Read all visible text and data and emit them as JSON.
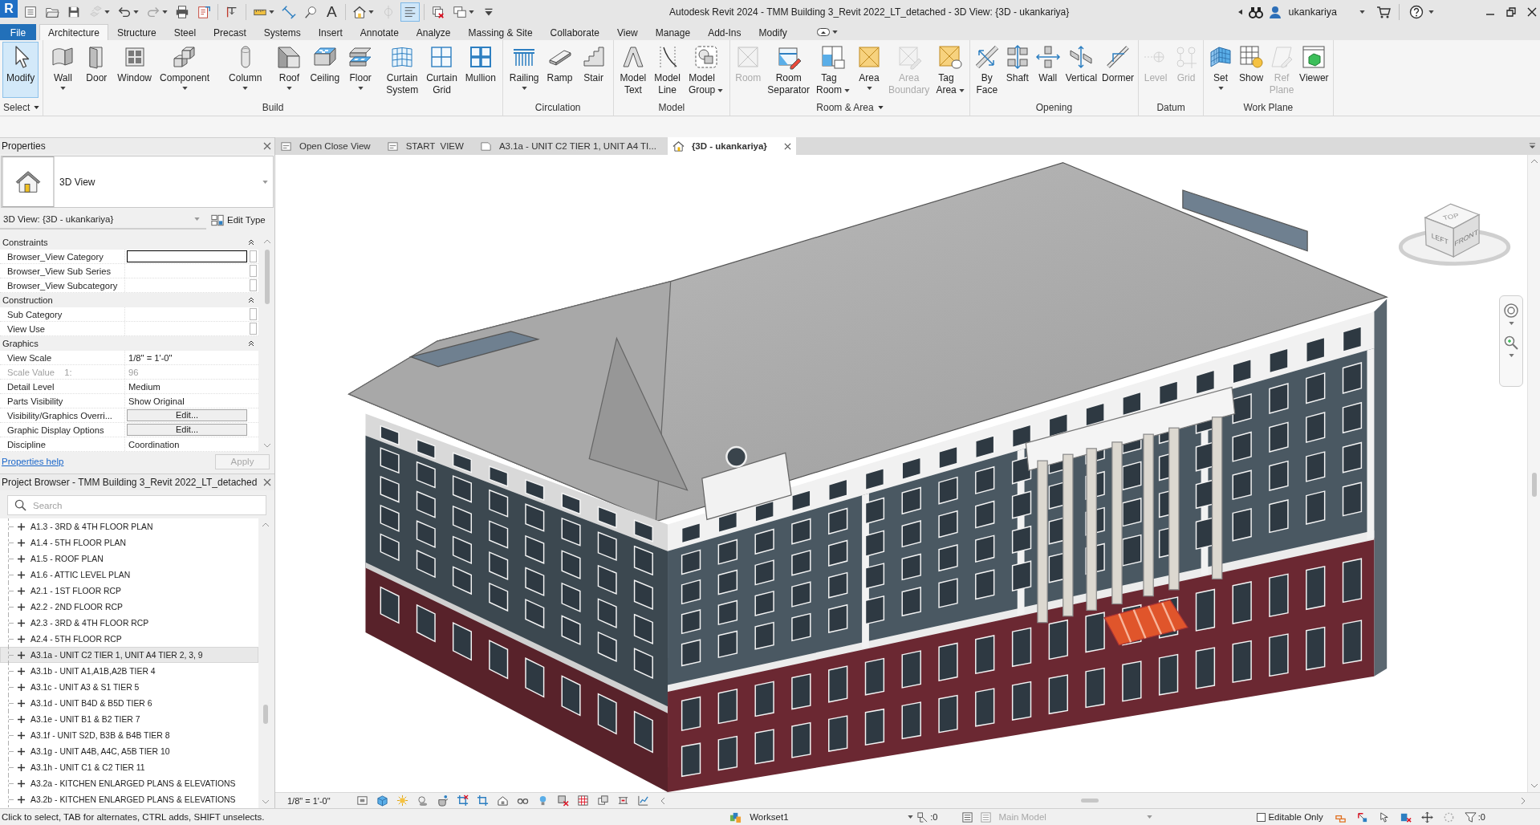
{
  "window": {
    "logo": "R",
    "title": "Autodesk Revit 2024 - TMM Building 3_Revit 2022_LT_detached - 3D View: {3D - ukankariya}",
    "user": "ukankariya"
  },
  "quick_access": [
    [
      {
        "kind": "list",
        "disabled": false,
        "on": false,
        "menu": false
      },
      {
        "kind": "open",
        "disabled": false,
        "on": false,
        "menu": false
      },
      {
        "kind": "save",
        "disabled": false,
        "on": false,
        "menu": false
      },
      {
        "kind": "sync",
        "disabled": true,
        "on": false,
        "menu": true
      },
      {
        "kind": "undo",
        "disabled": false,
        "on": false,
        "menu": true
      },
      {
        "kind": "redo",
        "disabled": true,
        "on": false,
        "menu": true
      },
      {
        "kind": "print",
        "disabled": false,
        "on": false,
        "menu": false
      },
      {
        "kind": "export",
        "disabled": false,
        "on": false,
        "menu": false
      }
    ],
    [
      {
        "kind": "level",
        "disabled": false,
        "on": false,
        "menu": false
      }
    ],
    [
      {
        "kind": "measure",
        "disabled": false,
        "on": false,
        "menu": true
      },
      {
        "kind": "dimension",
        "disabled": false,
        "on": false,
        "menu": false
      },
      {
        "kind": "tag",
        "disabled": false,
        "on": false,
        "menu": false
      },
      {
        "kind": "text",
        "glyph": "A",
        "disabled": false,
        "on": false,
        "menu": false
      }
    ],
    [
      {
        "kind": "home",
        "disabled": false,
        "on": false,
        "menu": true
      },
      {
        "kind": "section",
        "disabled": true,
        "on": false,
        "menu": false
      },
      {
        "kind": "thin_lines",
        "disabled": false,
        "on": true,
        "menu": false
      }
    ],
    [
      {
        "kind": "close_hidden",
        "disabled": false,
        "on": false,
        "menu": false
      },
      {
        "kind": "switch_windows",
        "disabled": false,
        "on": false,
        "menu": true
      },
      {
        "kind": "customize",
        "disabled": false,
        "on": false,
        "menu": false
      }
    ]
  ],
  "ribbon_tabs": [
    {
      "label": "File",
      "kind": "file",
      "selected": false
    },
    {
      "label": "Architecture",
      "kind": "tab",
      "selected": true
    },
    {
      "label": "Structure",
      "kind": "tab",
      "selected": false
    },
    {
      "label": "Steel",
      "kind": "tab",
      "selected": false
    },
    {
      "label": "Precast",
      "kind": "tab",
      "selected": false
    },
    {
      "label": "Systems",
      "kind": "tab",
      "selected": false
    },
    {
      "label": "Insert",
      "kind": "tab",
      "selected": false
    },
    {
      "label": "Annotate",
      "kind": "tab",
      "selected": false
    },
    {
      "label": "Analyze",
      "kind": "tab",
      "selected": false
    },
    {
      "label": "Massing & Site",
      "kind": "tab",
      "selected": false
    },
    {
      "label": "Collaborate",
      "kind": "tab",
      "selected": false
    },
    {
      "label": "View",
      "kind": "tab",
      "selected": false
    },
    {
      "label": "Manage",
      "kind": "tab",
      "selected": false
    },
    {
      "label": "Add-Ins",
      "kind": "tab",
      "selected": false
    },
    {
      "label": "Modify",
      "kind": "tab",
      "selected": false
    }
  ],
  "ribbon_panels": [
    {
      "title": "Select",
      "menu": true,
      "tools": [
        {
          "label": "Modify",
          "kind": "pointer",
          "selected": true,
          "disabled": false,
          "dropdown": false
        }
      ]
    },
    {
      "title": "Build",
      "menu": false,
      "tools": [
        {
          "label": "Wall",
          "kind": "wall",
          "selected": false,
          "disabled": false,
          "dropdown": true
        },
        {
          "label": "Door",
          "kind": "door",
          "selected": false,
          "disabled": false,
          "dropdown": false
        },
        {
          "label": "Window",
          "kind": "window",
          "selected": false,
          "disabled": false,
          "dropdown": false
        },
        {
          "label": "Component",
          "kind": "component",
          "selected": false,
          "disabled": false,
          "dropdown": true
        },
        {
          "label": "Column",
          "kind": "column",
          "selected": false,
          "disabled": false,
          "dropdown": true
        },
        {
          "label": "Roof",
          "kind": "roof",
          "selected": false,
          "disabled": false,
          "dropdown": true
        },
        {
          "label": "Ceiling",
          "kind": "ceiling",
          "selected": false,
          "disabled": false,
          "dropdown": false
        },
        {
          "label": "Floor",
          "kind": "floor",
          "selected": false,
          "disabled": false,
          "dropdown": true
        },
        {
          "label": "Curtain System",
          "kind": "curtain_system",
          "selected": false,
          "disabled": false,
          "dropdown": false
        },
        {
          "label": "Curtain Grid",
          "kind": "curtain_grid",
          "selected": false,
          "disabled": false,
          "dropdown": false
        },
        {
          "label": "Mullion",
          "kind": "mullion",
          "selected": false,
          "disabled": false,
          "dropdown": false
        }
      ]
    },
    {
      "title": "Circulation",
      "menu": false,
      "tools": [
        {
          "label": "Railing",
          "kind": "railing",
          "selected": false,
          "disabled": false,
          "dropdown": true
        },
        {
          "label": "Ramp",
          "kind": "ramp",
          "selected": false,
          "disabled": false,
          "dropdown": false
        },
        {
          "label": "Stair",
          "kind": "stair",
          "selected": false,
          "disabled": false,
          "dropdown": false
        }
      ]
    },
    {
      "title": "Model",
      "menu": false,
      "tools": [
        {
          "label": "Model Text",
          "kind": "model_text",
          "selected": false,
          "disabled": false,
          "dropdown": false
        },
        {
          "label": "Model Line",
          "kind": "model_line",
          "selected": false,
          "disabled": false,
          "dropdown": false
        },
        {
          "label": "Model Group",
          "kind": "model_group",
          "selected": false,
          "disabled": false,
          "dropdown": true
        }
      ]
    },
    {
      "title": "Room & Area",
      "menu": true,
      "tools": [
        {
          "label": "Room",
          "kind": "room",
          "selected": false,
          "disabled": true,
          "dropdown": false
        },
        {
          "label": "Room Separator",
          "kind": "room_separator",
          "selected": false,
          "disabled": false,
          "dropdown": false
        },
        {
          "label": "Tag Room",
          "kind": "tag_room",
          "selected": false,
          "disabled": false,
          "dropdown": true
        },
        {
          "label": "Area",
          "kind": "area",
          "selected": false,
          "disabled": false,
          "dropdown": true
        },
        {
          "label": "Area Boundary",
          "kind": "area_boundary",
          "selected": false,
          "disabled": true,
          "dropdown": false
        },
        {
          "label": "Tag Area",
          "kind": "tag_area",
          "selected": false,
          "disabled": false,
          "dropdown": true
        }
      ]
    },
    {
      "title": "Opening",
      "menu": false,
      "tools": [
        {
          "label": "By Face",
          "kind": "by_face",
          "selected": false,
          "disabled": false,
          "dropdown": false
        },
        {
          "label": "Shaft",
          "kind": "shaft",
          "selected": false,
          "disabled": false,
          "dropdown": false
        },
        {
          "label": "Wall",
          "kind": "wall_opening",
          "selected": false,
          "disabled": false,
          "dropdown": false
        },
        {
          "label": "Vertical",
          "kind": "vertical",
          "selected": false,
          "disabled": false,
          "dropdown": false
        },
        {
          "label": "Dormer",
          "kind": "dormer",
          "selected": false,
          "disabled": false,
          "dropdown": false
        }
      ]
    },
    {
      "title": "Datum",
      "menu": false,
      "tools": [
        {
          "label": "Level",
          "kind": "level",
          "selected": false,
          "disabled": true,
          "dropdown": false
        },
        {
          "label": "Grid",
          "kind": "grid",
          "selected": false,
          "disabled": true,
          "dropdown": false
        }
      ]
    },
    {
      "title": "Work Plane",
      "menu": false,
      "tools": [
        {
          "label": "Set",
          "kind": "set",
          "selected": false,
          "disabled": false,
          "dropdown": true
        },
        {
          "label": "Show",
          "kind": "show",
          "selected": false,
          "disabled": false,
          "dropdown": false
        },
        {
          "label": "Ref Plane",
          "kind": "ref_plane",
          "selected": false,
          "disabled": true,
          "dropdown": false
        },
        {
          "label": "Viewer",
          "kind": "viewer",
          "selected": false,
          "disabled": false,
          "dropdown": false
        }
      ]
    }
  ],
  "properties": {
    "title": "Properties",
    "type_name": "3D View",
    "instance": "3D View: {3D - ukankariya}",
    "edit_type": "Edit Type",
    "groups": [
      {
        "name": "Constraints",
        "expanded": true,
        "rows": [
          {
            "name": "Browser_View Category",
            "kind": "input",
            "param": true,
            "disabled": false
          },
          {
            "name": "Browser_View Sub Series",
            "kind": "text",
            "param": true,
            "disabled": false
          },
          {
            "name": "Browser_View Subcategory",
            "kind": "text",
            "param": true,
            "disabled": false
          }
        ]
      },
      {
        "name": "Construction",
        "expanded": true,
        "rows": [
          {
            "name": "Sub Category",
            "kind": "text",
            "param": true,
            "disabled": false
          },
          {
            "name": "View Use",
            "kind": "text",
            "param": true,
            "disabled": false
          }
        ]
      },
      {
        "name": "Graphics",
        "expanded": true,
        "rows": [
          {
            "name": "View Scale",
            "value": "1/8\" = 1'-0\"",
            "kind": "text",
            "param": false,
            "disabled": false
          },
          {
            "name": "Scale Value    1:",
            "value": "96",
            "kind": "text",
            "param": false,
            "disabled": true
          },
          {
            "name": "Detail Level",
            "value": "Medium",
            "kind": "text",
            "param": false,
            "disabled": false
          },
          {
            "name": "Parts Visibility",
            "value": "Show Original",
            "kind": "text",
            "param": false,
            "disabled": false
          },
          {
            "name": "Visibility/Graphics Overri...",
            "value": "Edit...",
            "kind": "button",
            "param": false,
            "disabled": false
          },
          {
            "name": "Graphic Display Options",
            "value": "Edit...",
            "kind": "button",
            "param": false,
            "disabled": false
          },
          {
            "name": "Discipline",
            "value": "Coordination",
            "kind": "text",
            "param": false,
            "disabled": false
          }
        ]
      }
    ],
    "help": "Properties help",
    "apply": {
      "label": "Apply",
      "disabled": true
    }
  },
  "project_browser": {
    "title": "Project Browser - TMM Building 3_Revit 2022_LT_detached",
    "search_placeholder": "Search",
    "items": [
      {
        "label": "A1.3 - 3RD & 4TH FLOOR PLAN",
        "expanded": false,
        "selected": false
      },
      {
        "label": "A1.4 - 5TH FLOOR PLAN",
        "expanded": false,
        "selected": false
      },
      {
        "label": "A1.5 - ROOF PLAN",
        "expanded": false,
        "selected": false
      },
      {
        "label": "A1.6 - ATTIC LEVEL PLAN",
        "expanded": false,
        "selected": false
      },
      {
        "label": "A2.1 - 1ST FLOOR RCP",
        "expanded": false,
        "selected": false
      },
      {
        "label": "A2.2 - 2ND FLOOR RCP",
        "expanded": false,
        "selected": false
      },
      {
        "label": "A2.3 - 3RD & 4TH FLOOR RCP",
        "expanded": false,
        "selected": false
      },
      {
        "label": "A2.4 - 5TH FLOOR RCP",
        "expanded": false,
        "selected": false
      },
      {
        "label": "A3.1a - UNIT C2 TIER 1, UNIT A4 TIER 2, 3, 9",
        "expanded": false,
        "selected": true
      },
      {
        "label": "A3.1b - UNIT A1,A1B,A2B TIER 4",
        "expanded": false,
        "selected": false
      },
      {
        "label": "A3.1c - UNIT A3 & S1 TIER 5",
        "expanded": false,
        "selected": false
      },
      {
        "label": "A3.1d - UNIT B4D & B5D TIER 6",
        "expanded": false,
        "selected": false
      },
      {
        "label": "A3.1e - UNIT B1 & B2 TIER 7",
        "expanded": false,
        "selected": false
      },
      {
        "label": "A3.1f - UNIT S2D, B3B & B4B TIER 8",
        "expanded": false,
        "selected": false
      },
      {
        "label": "A3.1g - UNIT A4B, A4C, A5B TIER 10",
        "expanded": false,
        "selected": false
      },
      {
        "label": "A3.1h - UNIT C1 & C2 TIER 11",
        "expanded": false,
        "selected": false
      },
      {
        "label": "A3.2a - KITCHEN ENLARGED PLANS & ELEVATIONS",
        "expanded": false,
        "selected": false
      },
      {
        "label": "A3.2b - KITCHEN ENLARGED PLANS & ELEVATIONS",
        "expanded": false,
        "selected": false
      }
    ]
  },
  "view_tabs": [
    {
      "label": "Open Close View",
      "kind": "view",
      "selected": false
    },
    {
      "label": "START  VIEW",
      "kind": "view",
      "selected": false
    },
    {
      "label": "A3.1a - UNIT C2 TIER 1, UNIT A4 TI...",
      "kind": "sheet",
      "selected": false
    },
    {
      "label": "{3D - ukankariya}",
      "kind": "model",
      "selected": true
    }
  ],
  "view": {
    "scale": "1/8\" = 1'-0\"",
    "view_cube": {
      "top": "TOP",
      "left": "LEFT",
      "front": "FRONT"
    }
  },
  "status_bar": {
    "hint": "Click to select, TAB for alternates, CTRL adds, SHIFT unselects.",
    "workset": "Workset1",
    "editable_count": ":0",
    "design_option": {
      "label": "Main Model",
      "disabled": true
    },
    "editable_only": {
      "label": "Editable Only",
      "checked": false
    },
    "filter_count": ":0"
  }
}
